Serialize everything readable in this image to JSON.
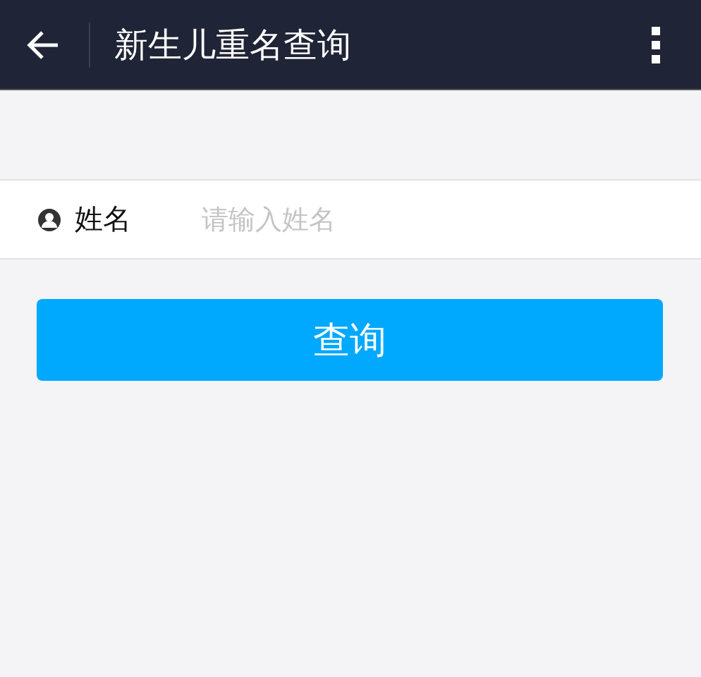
{
  "header": {
    "title": "新生儿重名查询"
  },
  "form": {
    "fields": [
      {
        "label": "姓名",
        "placeholder": "请输入姓名"
      }
    ]
  },
  "buttons": [
    "查询"
  ]
}
